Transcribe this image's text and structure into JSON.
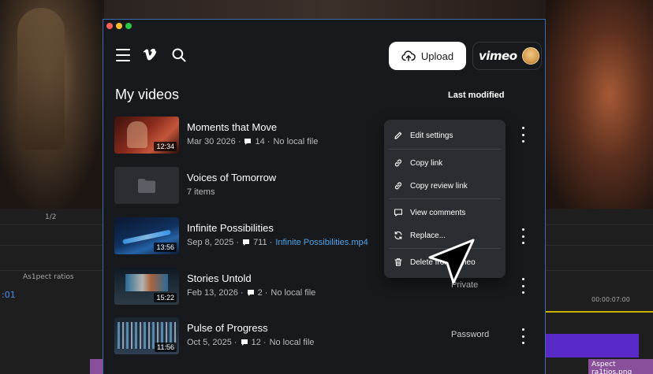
{
  "background_editor": {
    "zoom_fraction": "1/2",
    "timeline_label": "As1pect ratios",
    "timecode_prefix": ":01",
    "timecode_right": "00:00:07:00",
    "clip_label": "Aspect ra1tios.png"
  },
  "window": {
    "accent_color": "#3a6ab0"
  },
  "header": {
    "menu_icon": "hamburger-icon",
    "logo_icon": "vimeo-v-icon",
    "search_icon": "search-icon",
    "upload_label": "Upload",
    "brand_label": "vimeo",
    "avatar_icon": "avatar"
  },
  "main": {
    "title": "My videos",
    "sort_label": "Last modified",
    "videos": [
      {
        "title": "Moments that Move",
        "duration": "12:34",
        "date": "Mar 30 2026 ·",
        "comments": "14 ·",
        "file": "No local file",
        "privacy": ""
      },
      {
        "title": "Voices of Tomorrow",
        "meta": "7 items",
        "type": "folder"
      },
      {
        "title": "Infinite Possibilities",
        "duration": "13:56",
        "date": "Sep 8, 2025 ·",
        "comments": "711 ·",
        "file": "Infinite Possibilities.mp4",
        "privacy": ""
      },
      {
        "title": "Stories Untold",
        "duration": "15:22",
        "date": "Feb 13, 2026 ·",
        "comments": "2 ·",
        "file": "No local file",
        "privacy": "Private"
      },
      {
        "title": "Pulse of Progress",
        "duration": "11:56",
        "date": "Oct 5, 2025 ·",
        "comments": "12 ·",
        "file": "No local file",
        "privacy": "Password"
      }
    ]
  },
  "context_menu": {
    "items": [
      {
        "label": "Edit settings",
        "icon": "pencil-icon"
      },
      {
        "label": "Copy link",
        "icon": "link-icon"
      },
      {
        "label": "Copy review link",
        "icon": "link-icon"
      },
      {
        "label": "View comments",
        "icon": "comment-icon"
      },
      {
        "label": "Replace...",
        "icon": "refresh-icon"
      },
      {
        "label": "Delete from Vimeo",
        "icon": "trash-icon"
      }
    ]
  }
}
